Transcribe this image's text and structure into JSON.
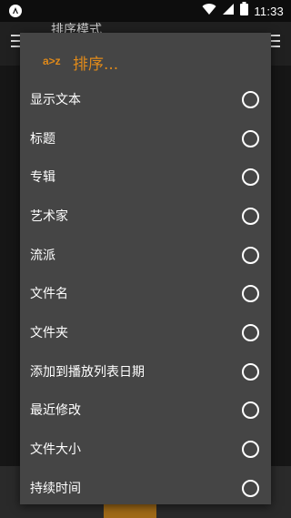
{
  "status_bar": {
    "time": "11:33"
  },
  "app_bar": {
    "title": "排序模式"
  },
  "dialog": {
    "icon_text": "a>z",
    "title": "排序...",
    "options": [
      {
        "label": "显示文本"
      },
      {
        "label": "标题"
      },
      {
        "label": "专辑"
      },
      {
        "label": "艺术家"
      },
      {
        "label": "流派"
      },
      {
        "label": "文件名"
      },
      {
        "label": "文件夹"
      },
      {
        "label": "添加到播放列表日期"
      },
      {
        "label": "最近修改"
      },
      {
        "label": "文件大小"
      },
      {
        "label": "持续时间"
      }
    ]
  },
  "colors": {
    "accent": "#e08a1a",
    "dialog_bg": "#454545"
  }
}
